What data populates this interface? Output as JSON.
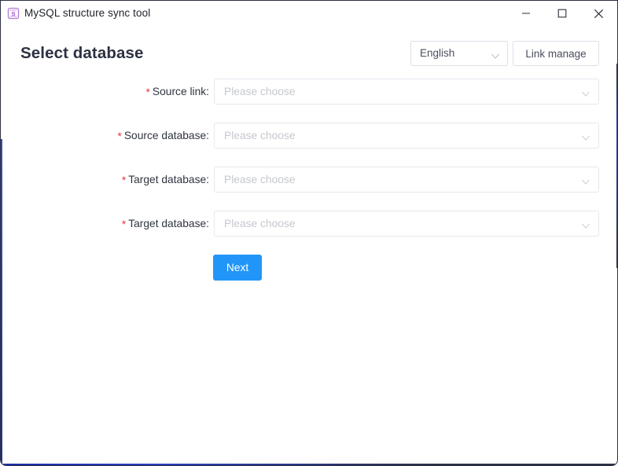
{
  "window": {
    "title": "MySQL structure sync tool",
    "icon": "database-s-icon",
    "accent_color": "#2439b8",
    "controls": {
      "minimize": "Minimize",
      "maximize": "Maximize",
      "close": "Close"
    }
  },
  "header": {
    "page_title": "Select database",
    "language_select": {
      "value": "English",
      "chevron": "chevron-down-icon"
    },
    "link_manage_label": "Link manage"
  },
  "form": {
    "required_marker": "*",
    "rows": [
      {
        "label": "Source link:",
        "required": true,
        "placeholder": "Please choose",
        "value": ""
      },
      {
        "label": "Source database:",
        "required": true,
        "placeholder": "Please choose",
        "value": ""
      },
      {
        "label": "Target database:",
        "required": true,
        "placeholder": "Please choose",
        "value": ""
      },
      {
        "label": "Target database:",
        "required": true,
        "placeholder": "Please choose",
        "value": ""
      }
    ]
  },
  "actions": {
    "next_label": "Next",
    "next_color": "#2196f8"
  }
}
